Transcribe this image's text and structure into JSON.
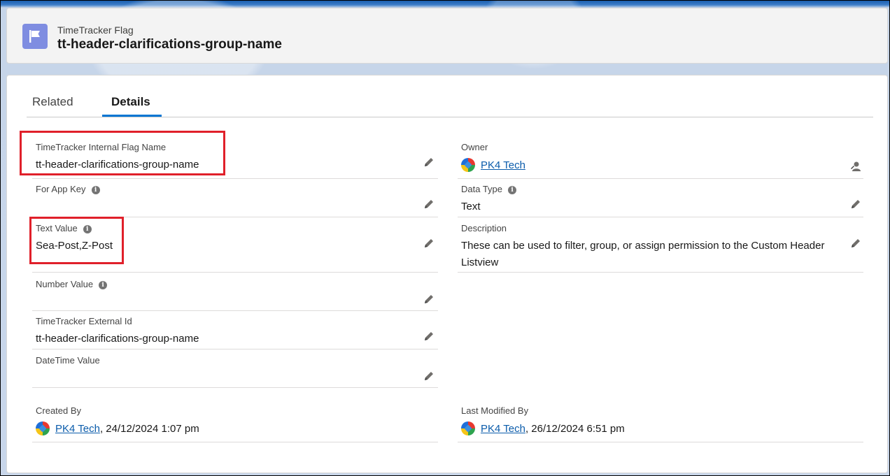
{
  "header": {
    "object_type": "TimeTracker Flag",
    "record_name": "tt-header-clarifications-group-name"
  },
  "tabs": [
    {
      "label": "Related"
    },
    {
      "label": "Details"
    }
  ],
  "fields": {
    "internal_flag_name": {
      "label": "TimeTracker Internal Flag Name",
      "value": "tt-header-clarifications-group-name"
    },
    "for_app_key": {
      "label": "For App Key",
      "value": ""
    },
    "text_value": {
      "label": "Text Value",
      "value": "Sea-Post,Z-Post"
    },
    "number_value": {
      "label": "Number Value",
      "value": ""
    },
    "external_id": {
      "label": "TimeTracker External Id",
      "value": "tt-header-clarifications-group-name"
    },
    "datetime_value": {
      "label": "DateTime Value",
      "value": ""
    },
    "owner": {
      "label": "Owner",
      "value": "PK4 Tech"
    },
    "data_type": {
      "label": "Data Type",
      "value": "Text"
    },
    "description": {
      "label": "Description",
      "value": "These can be used to filter, group, or assign permission to the Custom Header Listview"
    },
    "created_by": {
      "label": "Created By",
      "user": "PK4 Tech",
      "date": ", 24/12/2024 1:07 pm"
    },
    "last_modified_by": {
      "label": "Last Modified By",
      "user": "PK4 Tech",
      "date": ", 26/12/2024 6:51 pm"
    }
  },
  "icons": {
    "info": "i"
  },
  "colors": {
    "accent": "#0176d3",
    "link": "#0b5cab",
    "highlight": "#e0202a",
    "flag_icon_bg": "#7f8de1"
  }
}
